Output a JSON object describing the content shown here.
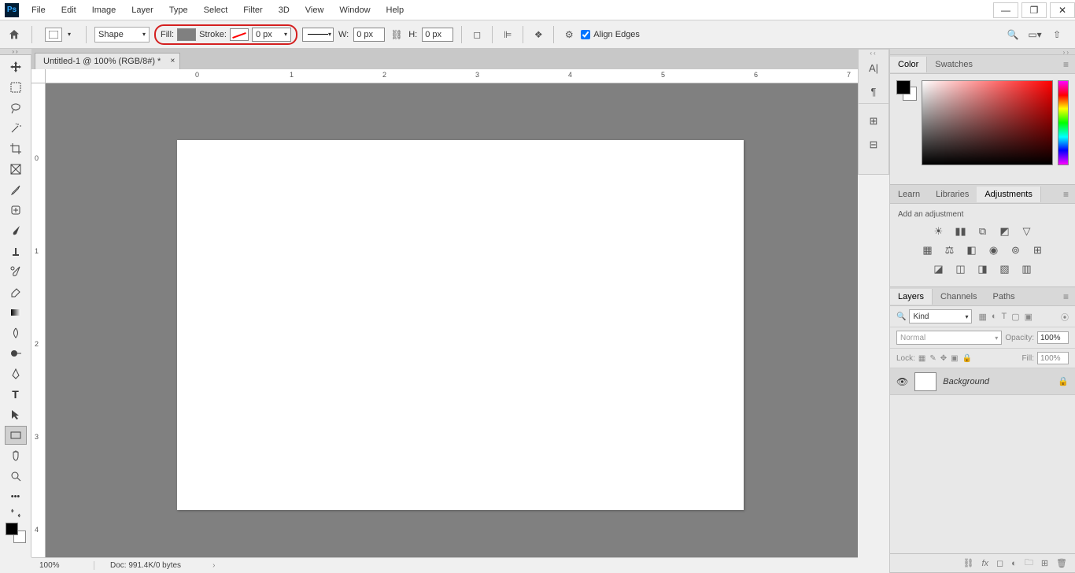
{
  "menubar": [
    "File",
    "Edit",
    "Image",
    "Layer",
    "Type",
    "Select",
    "Filter",
    "3D",
    "View",
    "Window",
    "Help"
  ],
  "options": {
    "shape_mode": "Shape",
    "fill_label": "Fill:",
    "stroke_label": "Stroke:",
    "stroke_width": "0 px",
    "w_label": "W:",
    "w_value": "0 px",
    "h_label": "H:",
    "h_value": "0 px",
    "align_edges": "Align Edges"
  },
  "tab": {
    "title": "Untitled-1 @ 100% (RGB/8#) *"
  },
  "ruler_h": [
    "0",
    "1",
    "2",
    "3",
    "4",
    "5",
    "6",
    "7"
  ],
  "ruler_v": [
    "0",
    "1",
    "2",
    "3",
    "4"
  ],
  "panels": {
    "color_tabs": [
      "Color",
      "Swatches"
    ],
    "adj_tabs": [
      "Learn",
      "Libraries",
      "Adjustments"
    ],
    "adj_hint": "Add an adjustment",
    "layer_tabs": [
      "Layers",
      "Channels",
      "Paths"
    ],
    "kind": "Kind",
    "blend": "Normal",
    "opacity_label": "Opacity:",
    "opacity_value": "100%",
    "lock_label": "Lock:",
    "fill_label": "Fill:",
    "fill_value": "100%",
    "layer_name": "Background"
  },
  "status": {
    "zoom": "100%",
    "doc": "Doc: 991.4K/0 bytes"
  }
}
